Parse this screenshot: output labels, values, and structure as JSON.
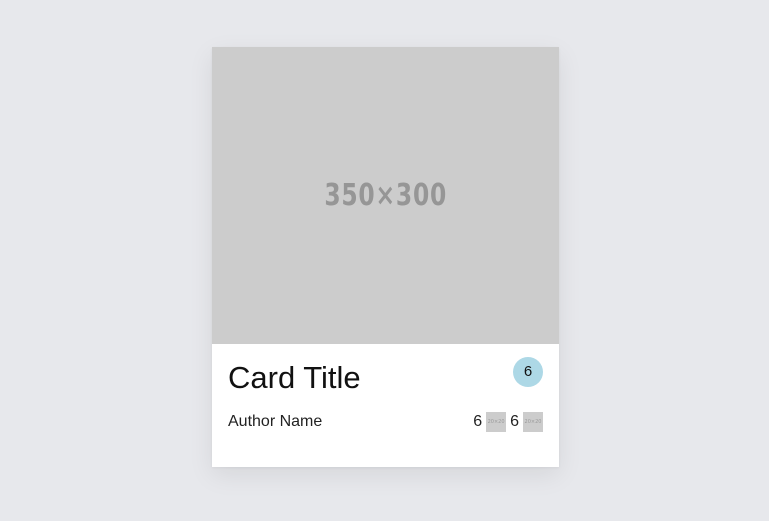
{
  "card": {
    "image_label": "350×300",
    "title": "Card Title",
    "badge_count": "6",
    "author": "Author Name",
    "stats": [
      {
        "count": "6",
        "icon": "placeholder-icon",
        "icon_label": "20×20"
      },
      {
        "count": "6",
        "icon": "placeholder-icon",
        "icon_label": "20×20"
      }
    ]
  },
  "colors": {
    "background": "#e7e8ec",
    "image_placeholder": "#cccccc",
    "badge": "#add8e6"
  }
}
